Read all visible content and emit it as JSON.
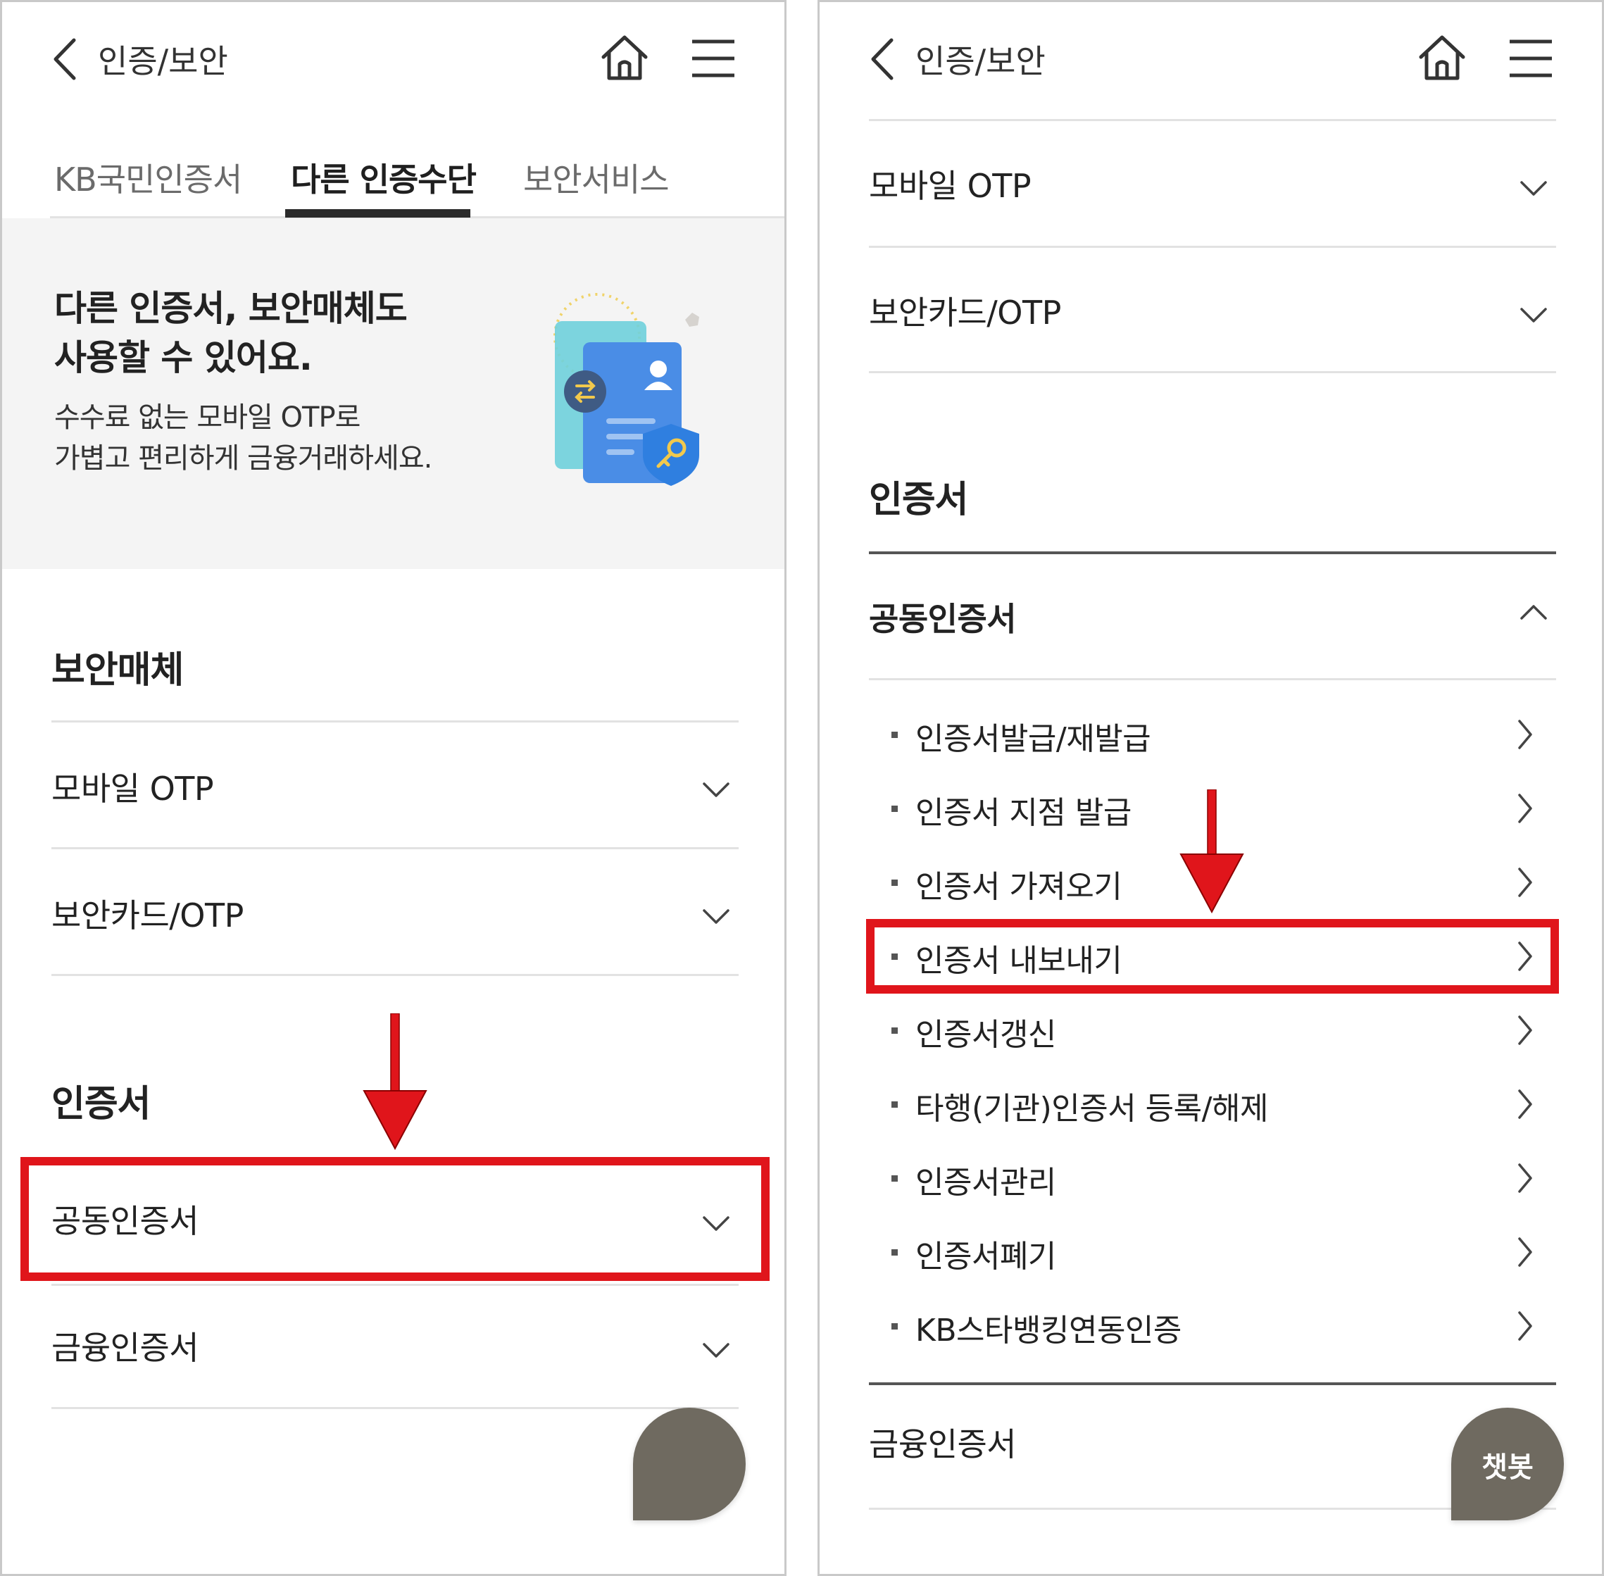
{
  "header": {
    "title": "인증/보안",
    "back_icon": "chevron-left-icon",
    "home_icon": "home-icon",
    "menu_icon": "hamburger-menu-icon"
  },
  "tabs": [
    {
      "label": "KB국민인증서",
      "active": false
    },
    {
      "label": "다른 인증수단",
      "active": true
    },
    {
      "label": "보안서비스",
      "active": false
    }
  ],
  "banner": {
    "title_line1": "다른 인증서, 보안매체도",
    "title_line2": "사용할 수 있어요.",
    "desc_line1": "수수료 없는 모바일 OTP로",
    "desc_line2": "가볍고 편리하게 금융거래하세요."
  },
  "left": {
    "security_section_title": "보안매체",
    "security_items": [
      "모바일 OTP",
      "보안카드/OTP"
    ],
    "cert_section_title": "인증서",
    "cert_items": [
      "공동인증서",
      "금융인증서"
    ]
  },
  "right": {
    "security_items": [
      "모바일 OTP",
      "보안카드/OTP"
    ],
    "cert_section_title": "인증서",
    "expanded_item": "공동인증서",
    "sub_items": [
      "인증서발급/재발급",
      "인증서 지점 발급",
      "인증서 가져오기",
      "인증서 내보내기",
      "인증서갱신",
      "타행(기관)인증서 등록/해제",
      "인증서관리",
      "인증서폐기",
      "KB스타뱅킹연동인증"
    ],
    "next_item": "금융인증서"
  },
  "chatbot": {
    "label": "챗봇"
  },
  "colors": {
    "highlight": "#e0151b",
    "chatbot": "#6f6a60",
    "banner_bg": "#f4f4f4",
    "tab_active": "#2b2b2b"
  }
}
